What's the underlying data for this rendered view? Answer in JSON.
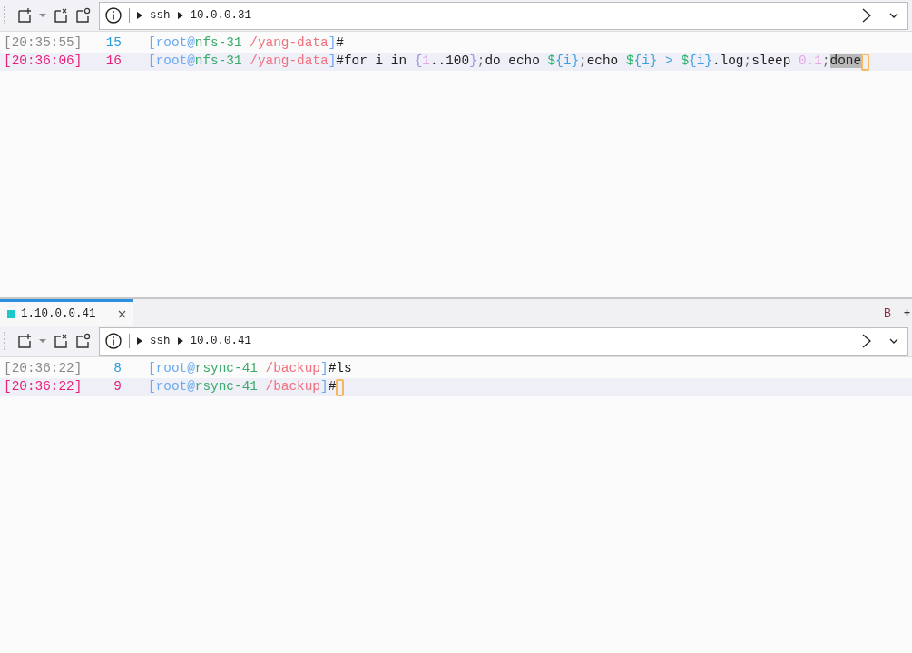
{
  "panes": [
    {
      "toolbar": {
        "path": [
          "ssh",
          "10.0.0.31"
        ]
      },
      "lines": [
        {
          "time": "[20:35:55]",
          "number": "15",
          "current": false,
          "cursor": false,
          "segments": [
            {
              "kind": "prompt-bracket",
              "text": "["
            },
            {
              "kind": "prompt-user",
              "text": "root@"
            },
            {
              "kind": "prompt-host",
              "text": "nfs-31"
            },
            {
              "kind": "prompt-path",
              "text": " /yang-data"
            },
            {
              "kind": "prompt-bracket",
              "text": "]"
            },
            {
              "kind": "plain",
              "text": "#"
            }
          ]
        },
        {
          "time": "[20:36:06]",
          "number": "16",
          "current": true,
          "cursor": true,
          "segments": [
            {
              "kind": "prompt-bracket",
              "text": "["
            },
            {
              "kind": "prompt-user",
              "text": "root@"
            },
            {
              "kind": "prompt-host",
              "text": "nfs-31"
            },
            {
              "kind": "prompt-path",
              "text": " /yang-data"
            },
            {
              "kind": "prompt-bracket",
              "text": "]"
            },
            {
              "kind": "plain",
              "text": "#for i in "
            },
            {
              "kind": "brace",
              "text": "{"
            },
            {
              "kind": "number",
              "text": "1"
            },
            {
              "kind": "plain",
              "text": "..100"
            },
            {
              "kind": "brace",
              "text": "}"
            },
            {
              "kind": "punct",
              "text": ";"
            },
            {
              "kind": "plain",
              "text": "do echo "
            },
            {
              "kind": "variable",
              "text": "$"
            },
            {
              "kind": "var-brace",
              "text": "{i}"
            },
            {
              "kind": "punct",
              "text": ";"
            },
            {
              "kind": "plain",
              "text": "echo "
            },
            {
              "kind": "variable",
              "text": "$"
            },
            {
              "kind": "var-brace",
              "text": "{i}"
            },
            {
              "kind": "operator",
              "text": " > "
            },
            {
              "kind": "variable",
              "text": "$"
            },
            {
              "kind": "var-brace",
              "text": "{i}"
            },
            {
              "kind": "plain",
              "text": ".log"
            },
            {
              "kind": "punct",
              "text": ";"
            },
            {
              "kind": "plain",
              "text": "sleep "
            },
            {
              "kind": "number",
              "text": "0.1"
            },
            {
              "kind": "punct",
              "text": ";"
            },
            {
              "kind": "highlight",
              "text": "done"
            }
          ]
        }
      ]
    },
    {
      "tab": {
        "label": "1.10.0.0.41",
        "color": "#1ec8c8",
        "selected": true,
        "right_labels": [
          "B",
          "+"
        ]
      },
      "toolbar": {
        "path": [
          "ssh",
          "10.0.0.41"
        ]
      },
      "lines": [
        {
          "time": "[20:36:22]",
          "number": "8",
          "current": false,
          "cursor": false,
          "segments": [
            {
              "kind": "prompt-bracket",
              "text": "["
            },
            {
              "kind": "prompt-user",
              "text": "root@"
            },
            {
              "kind": "prompt-host",
              "text": "rsync-41"
            },
            {
              "kind": "prompt-path",
              "text": " /backup"
            },
            {
              "kind": "prompt-bracket",
              "text": "]"
            },
            {
              "kind": "plain",
              "text": "#ls"
            }
          ]
        },
        {
          "time": "[20:36:22]",
          "number": "9",
          "current": true,
          "cursor": true,
          "segments": [
            {
              "kind": "prompt-bracket",
              "text": "["
            },
            {
              "kind": "prompt-user",
              "text": "root@"
            },
            {
              "kind": "prompt-host",
              "text": "rsync-41"
            },
            {
              "kind": "prompt-path",
              "text": " /backup"
            },
            {
              "kind": "prompt-bracket",
              "text": "]"
            },
            {
              "kind": "plain",
              "text": "#"
            }
          ]
        }
      ]
    }
  ]
}
